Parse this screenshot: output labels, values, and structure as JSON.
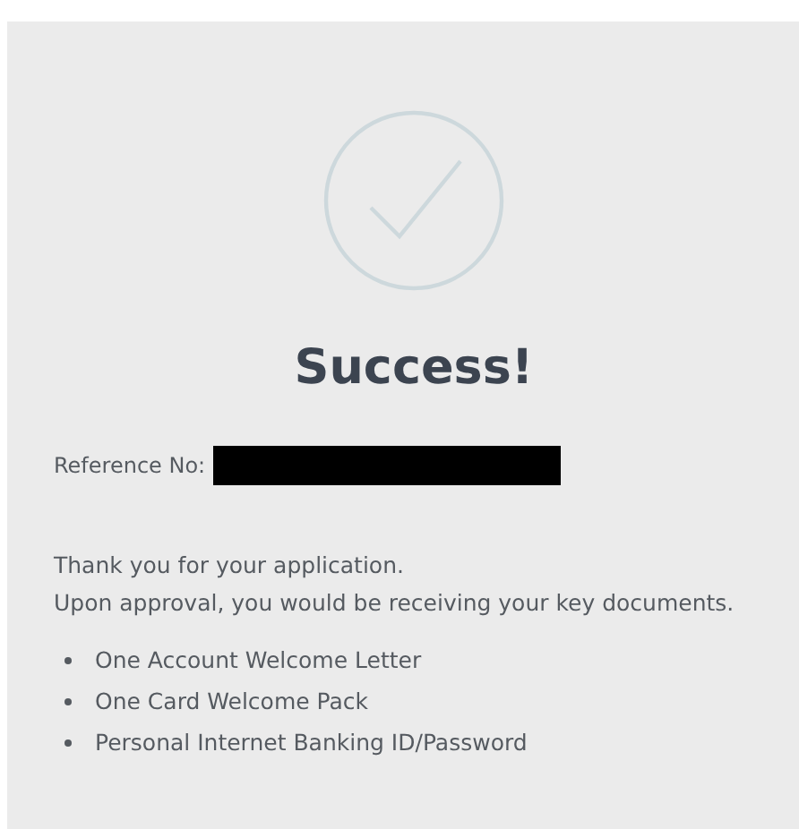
{
  "title": "Success!",
  "reference": {
    "label": "Reference No:"
  },
  "message": [
    "Thank you for your application.",
    "Upon approval, you would be receiving your key documents."
  ],
  "documents": [
    "One Account Welcome Letter",
    "One Card Welcome Pack",
    "Personal Internet Banking ID/Password"
  ]
}
